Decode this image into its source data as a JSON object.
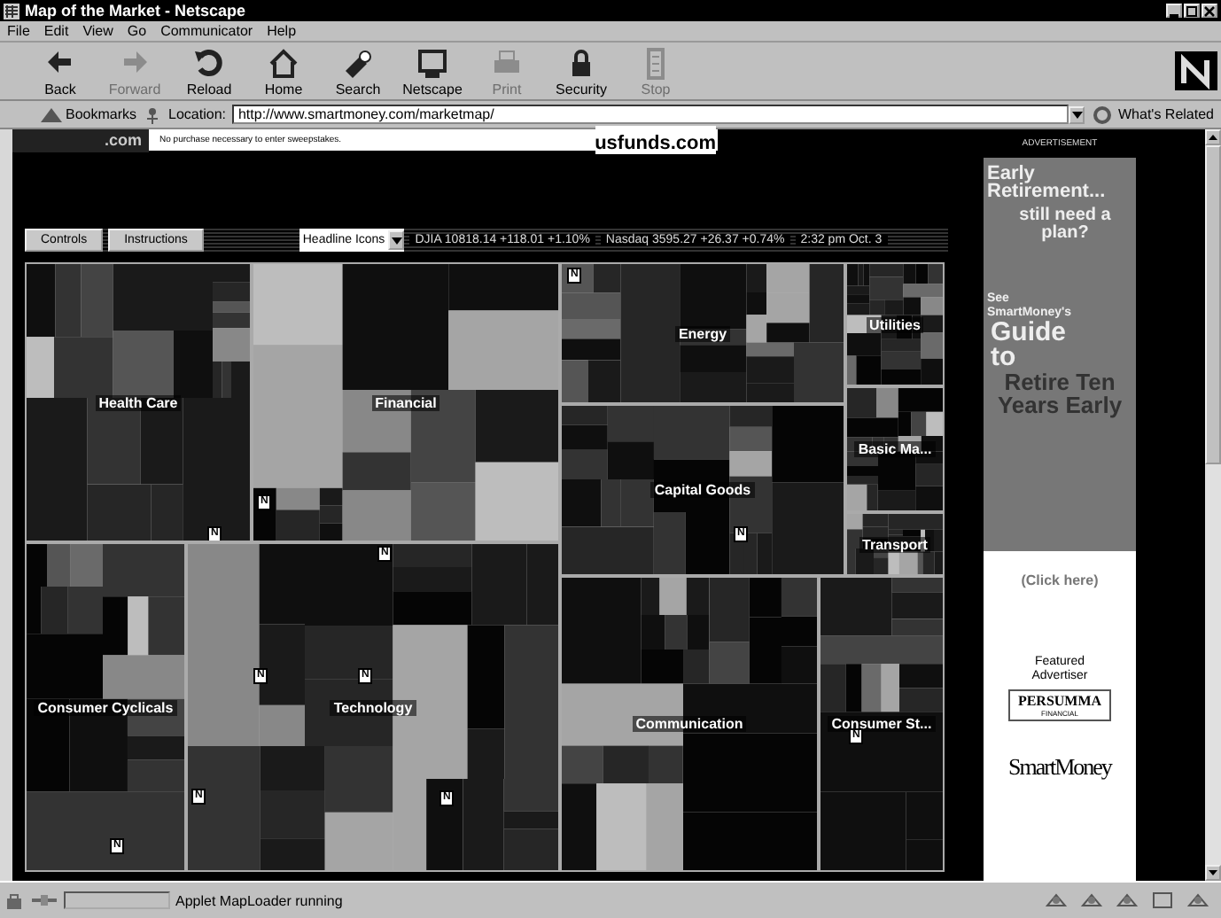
{
  "window": {
    "title": "Map of the Market - Netscape"
  },
  "menu": [
    "File",
    "Edit",
    "View",
    "Go",
    "Communicator",
    "Help"
  ],
  "toolbar": [
    {
      "kind": "back",
      "label": "Back",
      "disabled": false
    },
    {
      "kind": "forward",
      "label": "Forward",
      "disabled": true
    },
    {
      "kind": "reload",
      "label": "Reload",
      "disabled": false
    },
    {
      "kind": "home",
      "label": "Home",
      "disabled": false
    },
    {
      "kind": "search",
      "label": "Search",
      "disabled": false
    },
    {
      "kind": "netscape",
      "label": "Netscape",
      "disabled": false
    },
    {
      "kind": "print",
      "label": "Print",
      "disabled": true
    },
    {
      "kind": "security",
      "label": "Security",
      "disabled": false
    },
    {
      "kind": "stop",
      "label": "Stop",
      "disabled": true
    }
  ],
  "location_bar": {
    "bookmarks": "Bookmarks",
    "label": "Location:",
    "url": "http://www.smartmoney.com/marketmap/",
    "related": "What's Related"
  },
  "banner": {
    "site": ".com",
    "fine_print": "No purchase necessary to enter sweepstakes.",
    "sponsor": "usfunds.com"
  },
  "controls": {
    "buttons": [
      "Controls",
      "Instructions"
    ],
    "view_select": "Headline Icons",
    "djia": "DJIA 10818.14 +118.01 +1.10%",
    "nasdaq": "Nasdaq 3595.27 +26.37 +0.74%",
    "time": "2:32 pm  Oct. 3"
  },
  "map": {
    "sectors": [
      {
        "label": "Health Care",
        "headlines": [
          "N"
        ]
      },
      {
        "label": "Financial",
        "headlines": [
          "N"
        ]
      },
      {
        "label": "Energy",
        "headlines": [
          "N"
        ]
      },
      {
        "label": "Utilities"
      },
      {
        "label": "Basic Ma..."
      },
      {
        "label": "Capital Goods",
        "headlines": [
          "N"
        ]
      },
      {
        "label": "Transport"
      },
      {
        "label": "Consumer Cyclicals",
        "headlines": [
          "N"
        ]
      },
      {
        "label": "Technology",
        "headlines": [
          "N",
          "N",
          "N",
          "N",
          "N"
        ]
      },
      {
        "label": "Communication"
      },
      {
        "label": "Consumer St...",
        "headlines": [
          "N"
        ]
      }
    ]
  },
  "ad": {
    "heading": "ADVERTISEMENT",
    "line_1": "Early Retirement...",
    "line_2": "still need a plan?",
    "line_3": "See SmartMoney's",
    "line_4": "Guide to",
    "line_5": "Retire Ten Years Early",
    "link": "(Click here)",
    "featured": "Featured Advertiser",
    "advertiser": "PERSUMMA",
    "advertiser_sub": "FINANCIAL",
    "brand": "SmartMoney"
  },
  "status_bar": {
    "text": "Applet MapLoader running"
  }
}
